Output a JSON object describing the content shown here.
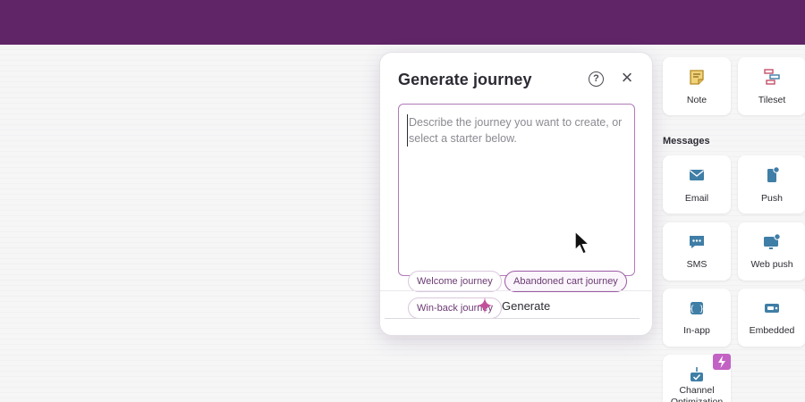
{
  "dialog": {
    "title": "Generate journey",
    "help_icon": "help-circle-icon",
    "close_icon": "close-icon",
    "prompt_placeholder": "Describe the journey you want to create, or select a starter below.",
    "starters": [
      "Welcome journey",
      "Abandoned cart journey",
      "Win-back journey"
    ],
    "generate_label": "Generate",
    "generate_icon": "sparkle-icon"
  },
  "panel": {
    "tiles": [
      {
        "label": "Note",
        "icon": "note-icon"
      },
      {
        "label": "Tileset",
        "icon": "tileset-icon"
      }
    ],
    "messages_heading": "Messages",
    "messages": [
      {
        "label": "Email",
        "icon": "email-icon"
      },
      {
        "label": "Push",
        "icon": "push-icon"
      },
      {
        "label": "SMS",
        "icon": "sms-icon"
      },
      {
        "label": "Web push",
        "icon": "web-push-icon"
      },
      {
        "label": "In-app",
        "icon": "in-app-icon"
      },
      {
        "label": "Embedded",
        "icon": "embedded-icon"
      },
      {
        "label": "Channel Optimization",
        "icon": "channel-optimization-icon"
      }
    ]
  },
  "colors": {
    "brand": "#5f2567",
    "accent": "#b07ab8",
    "icon_blue": "#3f7ea6",
    "note_yellow": "#e0b84a",
    "badge_pink": "#c262c4"
  }
}
